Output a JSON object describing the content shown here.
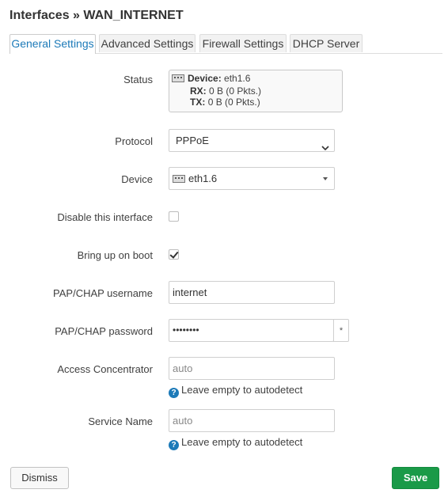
{
  "title": "Interfaces » WAN_INTERNET",
  "tabs": [
    {
      "label": "General Settings",
      "active": true
    },
    {
      "label": "Advanced Settings",
      "active": false
    },
    {
      "label": "Firewall Settings",
      "active": false
    },
    {
      "label": "DHCP Server",
      "active": false
    }
  ],
  "status": {
    "label": "Status",
    "device_key": "Device:",
    "device_val": "eth1.6",
    "rx_key": "RX:",
    "rx_val": "0 B (0 Pkts.)",
    "tx_key": "TX:",
    "tx_val": "0 B (0 Pkts.)"
  },
  "protocol": {
    "label": "Protocol",
    "value": "PPPoE"
  },
  "device": {
    "label": "Device",
    "value": "eth1.6"
  },
  "disable": {
    "label": "Disable this interface",
    "checked": false
  },
  "bringup": {
    "label": "Bring up on boot",
    "checked": true
  },
  "username": {
    "label": "PAP/CHAP username",
    "value": "internet"
  },
  "password": {
    "label": "PAP/CHAP password",
    "value": "••••••••",
    "reveal": "*"
  },
  "concentrator": {
    "label": "Access Concentrator",
    "placeholder": "auto",
    "hint": "Leave empty to autodetect"
  },
  "service": {
    "label": "Service Name",
    "placeholder": "auto",
    "hint": "Leave empty to autodetect"
  },
  "help_glyph": "?",
  "buttons": {
    "dismiss": "Dismiss",
    "save": "Save"
  },
  "colors": {
    "accent": "#1c7ab8",
    "save": "#1a9a48"
  }
}
